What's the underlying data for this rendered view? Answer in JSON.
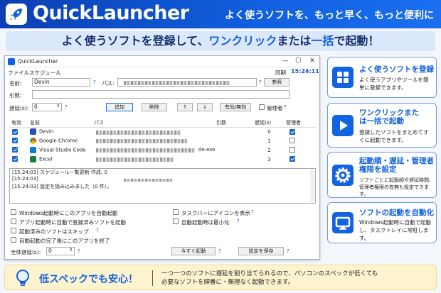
{
  "header": {
    "app_title": "QuickLauncher",
    "tagline": "よく使うソフトを、もっと早く、もっと便利に"
  },
  "banner": {
    "part1": "よく使うソフトを登録して、",
    "highlight1": "ワンクリック",
    "part2": "または",
    "highlight2": "一括",
    "part3": "で起動！"
  },
  "window": {
    "title": "QuickLauncher",
    "menu": [
      "ファイル",
      "スケジュール"
    ],
    "sync_label": "同期",
    "clock": "15:24:11",
    "form": {
      "name_label": "名前:",
      "name_value": "Devin",
      "path_label": "パス:",
      "browse_button": "参照",
      "args_label": "引数:",
      "delay_label": "遅延(s):",
      "delay_value": "0",
      "add_button": "追加",
      "delete_button": "削除",
      "up_button": "↑",
      "down_button": "↓",
      "toggle_button": "有効/無効",
      "admin_label": "管理者",
      "help": "?"
    },
    "table": {
      "headers": [
        "有効",
        "名前",
        "パス",
        "引数",
        "遅延(s)",
        "管理者"
      ],
      "rows": [
        {
          "enabled": true,
          "name": "Devin",
          "icon": "devin-icon",
          "args": "",
          "delay": "0",
          "admin": true
        },
        {
          "enabled": true,
          "name": "Google Chrome",
          "icon": "chrome-icon",
          "args": "",
          "delay": "1",
          "admin": false
        },
        {
          "enabled": true,
          "name": "Visual Studio Code",
          "icon": "vscode-icon",
          "args": "",
          "delay": "2",
          "admin": false,
          "path_suffix": "de.exe"
        },
        {
          "enabled": true,
          "name": "Excel",
          "icon": "excel-icon",
          "args": "",
          "delay": "3",
          "admin": true
        }
      ]
    },
    "log": [
      "[15:24:03] スケジュール一覧更新 作成: 0",
      "[15:24:03] ",
      "[15:24:03] 設定を読み込みました（0 件）。"
    ],
    "options": {
      "opt1": "Windows起動時にこのアプリを自動起動",
      "opt2": "アプリ起動時に自動で登録済みソフトを起動",
      "opt3": "起動済みのソフトはスキップ",
      "opt4": "自動起動の完了後にこのアプリを終了",
      "opt5": "タスクバーにアイコンを表示",
      "opt6": "自動起動時は最小化"
    },
    "global_delay_label": "全体遅延(s):",
    "global_delay_value": "0",
    "launch_now_button": "今すぐ起動",
    "save_button": "設定を保存"
  },
  "cards": [
    {
      "icon": "grid-icon",
      "title": "よく使うソフトを登録",
      "desc": "よく使うアプリやツールを簡単に登録できます。"
    },
    {
      "icon": "play-icon",
      "title": "ワンクリックまたは一括で起動",
      "desc": "登録したソフトをまとめてすぐに起動できます。"
    },
    {
      "icon": "gear-icon",
      "title": "起動順・遅延・管理者権限を設定",
      "desc": "ソフトごとに起動順や遅延時間、管理者権限の有無も設定できます。"
    },
    {
      "icon": "monitor-icon",
      "title": "ソフトの起動を自動化",
      "desc": "Windows起動時に自動で起動し、タスクトレイに常駐します。"
    }
  ],
  "footer": {
    "headline": "低スペックでも安心！",
    "desc_line1": "一つ一つのソフトに遅延を割り当てられるので、パソコンのスペックが低くても",
    "desc_line2": "必要なソフトを順番に・無理なく起動できます。"
  },
  "colors": {
    "brand": "#1160e0",
    "header_dark": "#0b3fb3",
    "footer_bg": "#fdf4cf"
  }
}
